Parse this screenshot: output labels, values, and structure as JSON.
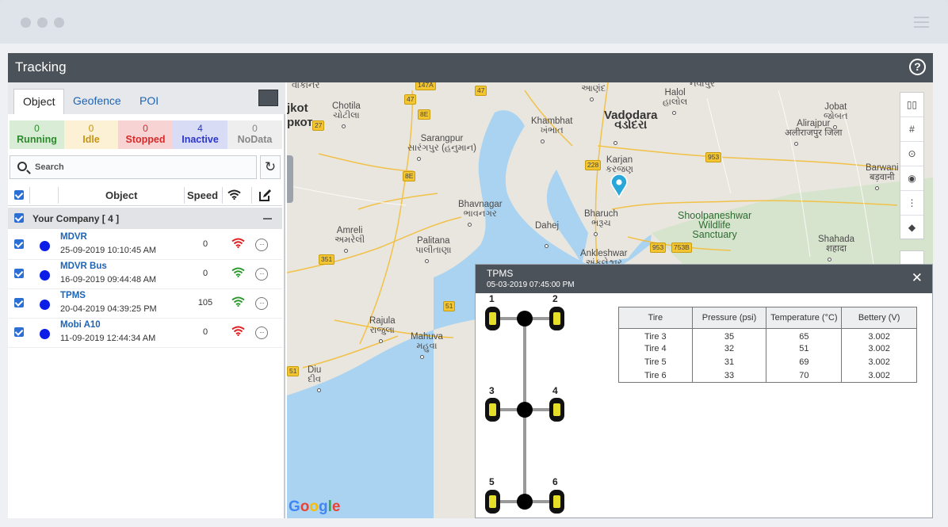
{
  "app": {
    "title": "Tracking"
  },
  "tabs": [
    {
      "label": "Object",
      "active": true
    },
    {
      "label": "Geofence",
      "active": false
    },
    {
      "label": "POI",
      "active": false
    }
  ],
  "status_counts": [
    {
      "label": "Running",
      "count": "0",
      "bg": "#d9ecd5",
      "color": "#2c8a2c"
    },
    {
      "label": "Idle",
      "count": "0",
      "bg": "#fcf1d4",
      "color": "#c49412"
    },
    {
      "label": "Stopped",
      "count": "0",
      "bg": "#f8d3d3",
      "color": "#d42a2a"
    },
    {
      "label": "Inactive",
      "count": "4",
      "bg": "#d9dcf5",
      "color": "#2b36c7"
    },
    {
      "label": "NoData",
      "count": "0",
      "bg": "#eeeeee",
      "color": "#888888"
    }
  ],
  "search": {
    "placeholder": "Search"
  },
  "table_header": {
    "object": "Object",
    "speed": "Speed"
  },
  "group": {
    "name": "Your Company [ 4 ]"
  },
  "objects": [
    {
      "name": "MDVR",
      "time": "25-09-2019 10:10:45 AM",
      "speed": "0",
      "signal": "#e02020"
    },
    {
      "name": "MDVR Bus",
      "time": "16-09-2019 09:44:48 AM",
      "speed": "0",
      "signal": "#2c9a2c"
    },
    {
      "name": "TPMS",
      "time": "20-04-2019 04:39:25 PM",
      "speed": "105",
      "signal": "#2c9a2c"
    },
    {
      "name": "Mobi A10",
      "time": "11-09-2019 12:44:34 AM",
      "speed": "0",
      "signal": "#e02020"
    }
  ],
  "map": {
    "places": [
      {
        "name": "Vadodara",
        "local": "વડોદરા",
        "big": true
      },
      {
        "name": "Anand",
        "local": "આણંદ"
      },
      {
        "name": "Halol",
        "local": "હાલોલ"
      },
      {
        "name": "Jobat",
        "local": "જોબત"
      },
      {
        "name": "Alirajpur",
        "local": "अलीराजपुर जिला"
      },
      {
        "name": "Chotila",
        "local": "ચોટીલા"
      },
      {
        "name": "Khambhat",
        "local": "ખંભાત"
      },
      {
        "name": "Sarangpur",
        "local": "સારંગપુર (હનુમાન)"
      },
      {
        "name": "Karjan",
        "local": "કરજણ"
      },
      {
        "name": "Barwani",
        "local": "बड़वानी"
      },
      {
        "name": "Bhavnagar",
        "local": "ભાવનગર"
      },
      {
        "name": "Bharuch",
        "local": "ભરૂચ"
      },
      {
        "name": "Dahej",
        "local": ""
      },
      {
        "name": "Amreli",
        "local": "અમરેલી"
      },
      {
        "name": "Palitana",
        "local": "પાલીતાણા"
      },
      {
        "name": "Ankleshwar",
        "local": "અંકલેશ્વર"
      },
      {
        "name": "Shahada",
        "local": "शहादा"
      },
      {
        "name": "Rajula",
        "local": "રાજુલા"
      },
      {
        "name": "Mahuva",
        "local": "મહુવા"
      },
      {
        "name": "Diu",
        "local": "દીવ"
      }
    ],
    "park": "Shoolpaneshwar\nWildlife\nSanctuary",
    "shields": [
      "147A",
      "47",
      "47",
      "8E",
      "27",
      "8E",
      "228",
      "953",
      "351",
      "51",
      "953",
      "753B",
      "51"
    ],
    "cut_texts": {
      "topleft": "વાંકાનેર",
      "rajkot": "jkot",
      "rajkot_local": "ркот",
      "top_right": "નવાપુર"
    },
    "google": "Google"
  },
  "tpms": {
    "title": "TPMS",
    "timestamp": "05-03-2019 07:45:00 PM",
    "tire_labels": [
      "1",
      "2",
      "3",
      "4",
      "5",
      "6"
    ],
    "columns": [
      "Tire",
      "Pressure (psi)",
      "Temperature (°C)",
      "Bettery (V)"
    ],
    "rows": [
      [
        "Tire 3",
        "35",
        "65",
        "3.002"
      ],
      [
        "Tire 4",
        "32",
        "51",
        "3.002"
      ],
      [
        "Tire 5",
        "31",
        "69",
        "3.002"
      ],
      [
        "Tire 6",
        "33",
        "70",
        "3.002"
      ]
    ]
  }
}
